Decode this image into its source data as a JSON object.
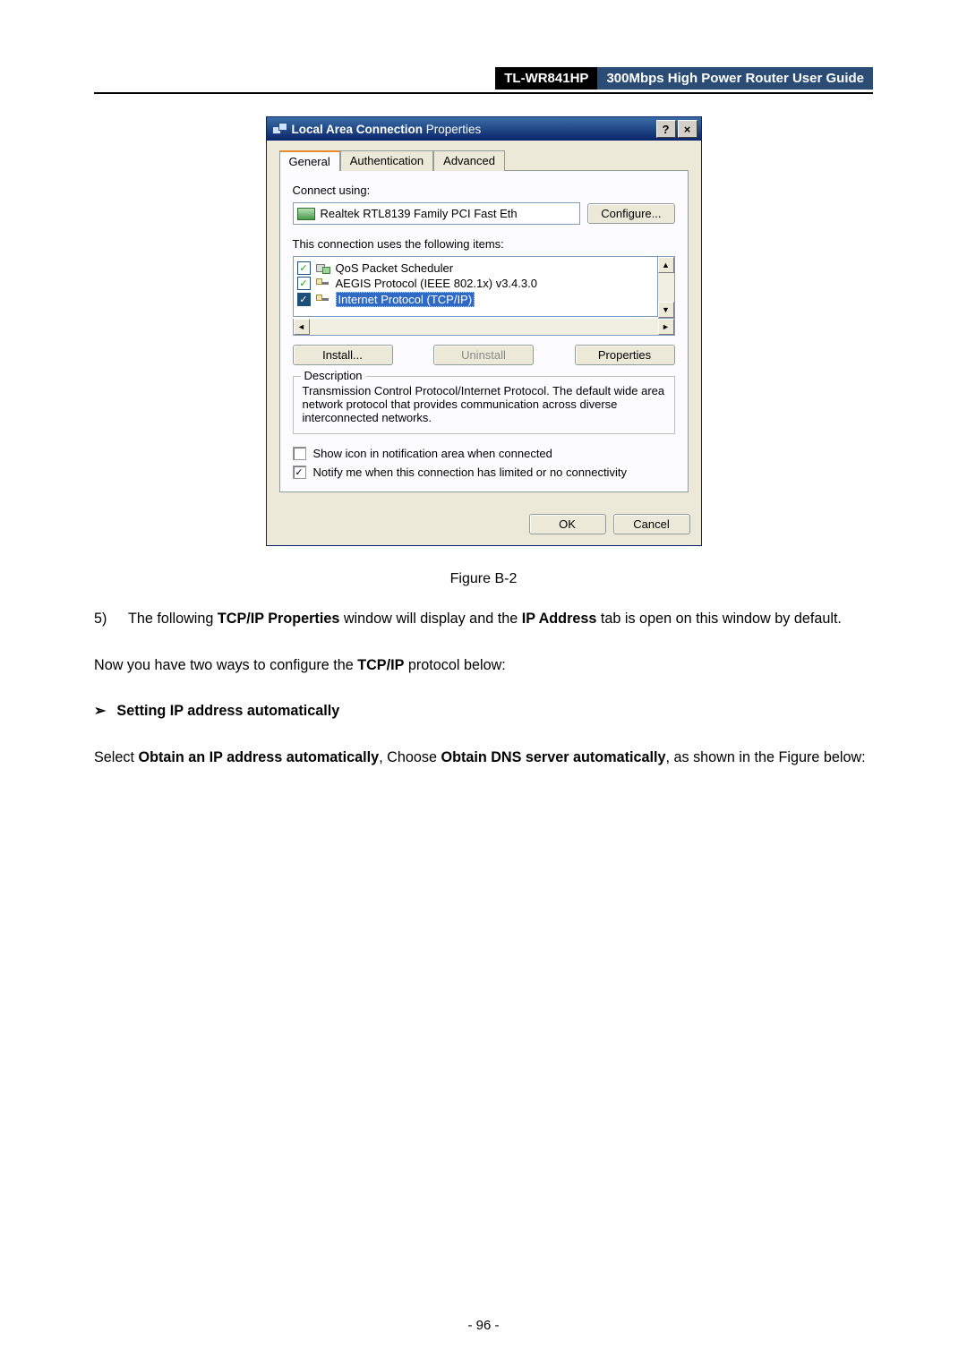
{
  "header": {
    "model": "TL-WR841HP",
    "title": "300Mbps High Power Router User Guide"
  },
  "dialog": {
    "title_bold": "Local Area Connection",
    "title_rest": "   Properties",
    "help": "?",
    "close": "×",
    "tabs": [
      "General",
      "Authentication",
      "Advanced"
    ],
    "connect_using_label": "Connect using:",
    "adapter": "Realtek RTL8139 Family PCI Fast Eth",
    "configure": "Configure...",
    "uses_label": "This connection uses the following items:",
    "items": [
      {
        "label": "QoS Packet Scheduler"
      },
      {
        "label": "AEGIS Protocol (IEEE 802.1x) v3.4.3.0"
      },
      {
        "label": "Internet Protocol (TCP/IP)"
      }
    ],
    "btns": {
      "install": "Install...",
      "uninstall": "Uninstall",
      "properties": "Properties"
    },
    "desc_legend": "Description",
    "desc_text": "Transmission Control Protocol/Internet Protocol. The default wide area network protocol that provides communication across diverse interconnected networks.",
    "show_icon": "Show icon in notification area when connected",
    "notify_me": "Notify me when this connection has limited or no connectivity",
    "ok": "OK",
    "cancel": "Cancel"
  },
  "caption": "Figure B-2",
  "step": {
    "num": "5)",
    "prefix": "The following ",
    "bold1": "TCP/IP Properties",
    "mid": " window will display and the ",
    "bold2": "IP Address",
    "suffix": " tab is open on this window by default."
  },
  "para1": {
    "a": "Now you have two ways to configure the ",
    "b": "TCP/IP",
    "c": " protocol below:"
  },
  "subheading": {
    "arrow": "➢",
    "text": "Setting IP address automatically"
  },
  "para2": {
    "a": "Select ",
    "b": "Obtain an IP address automatically",
    "c": ", Choose ",
    "d": "Obtain DNS server automatically",
    "e": ", as shown in the Figure below:"
  },
  "page_number": "- 96 -"
}
